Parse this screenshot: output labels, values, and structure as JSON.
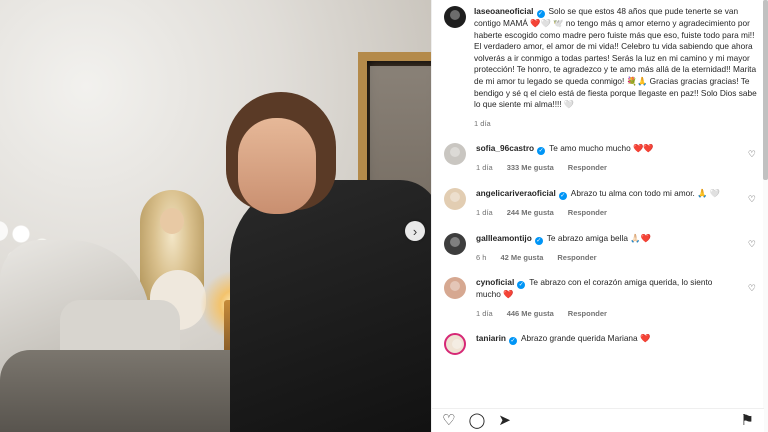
{
  "post": {
    "owner": "laseoaneoficial",
    "caption": "Solo se que estos 48 años que pude tenerte se van contigo MAMÁ ❤️🤍 🕊️ no tengo más q amor eterno y agradecimiento por haberte escogido como madre pero fuiste más que eso, fuiste todo para mi!! El verdadero amor, el amor de mi vida!! Celebro tu vida sabiendo que ahora volverás a ir conmigo a todas partes! Serás la luz en mi camino y mi mayor protección! Te honro, te agradezco y te amo más allá de la eternidad!! Marita de mi amor tu legado se queda conmigo! 💐🙏 Gracias gracias gracias! Te bendigo y sé q el cielo está de fiesta porque llegaste en paz!! Solo Dios sabe lo que siente mi alma!!!! 🤍",
    "time": "1 día"
  },
  "comments": [
    {
      "user": "sofia_96castro",
      "verified": true,
      "text": "Te amo mucho mucho ❤️❤️",
      "time": "1 día",
      "likes": "333 Me gusta",
      "reply": "Responder"
    },
    {
      "user": "angelicariveraoficial",
      "verified": true,
      "text": "Abrazo tu alma con todo mi amor. 🙏 🤍",
      "time": "1 día",
      "likes": "244 Me gusta",
      "reply": "Responder"
    },
    {
      "user": "gallleamontijo",
      "verified": true,
      "text": "Te abrazo amiga bella 🙏🏻❤️",
      "time": "6 h",
      "likes": "42 Me gusta",
      "reply": "Responder"
    },
    {
      "user": "cynoficial",
      "verified": true,
      "text": "Te abrazo con el corazón amiga querida, lo siento mucho ❤️",
      "time": "1 día",
      "likes": "446 Me gusta",
      "reply": "Responder"
    },
    {
      "user": "taniarin",
      "verified": true,
      "text": "Abrazo grande querida Mariana ❤️",
      "time": "",
      "likes": "",
      "reply": ""
    }
  ],
  "icons": {
    "like": "heart-outline-icon",
    "comment": "comment-icon",
    "share": "send-icon",
    "save": "bookmark-icon",
    "next": "chevron-right-icon"
  },
  "colors": {
    "verified": "#0095f6",
    "heart": "#ed4956",
    "meta": "#737373"
  }
}
